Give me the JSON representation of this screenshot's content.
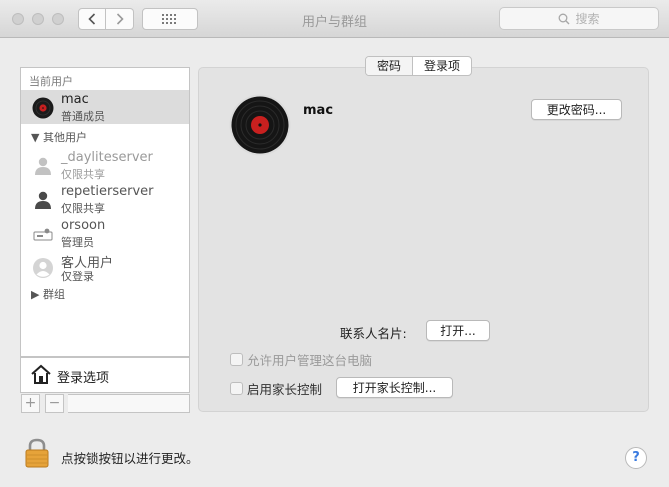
{
  "window": {
    "title": "用户与群组",
    "search_placeholder": "搜索"
  },
  "sidebar": {
    "current_users_header": "当前用户",
    "other_users_header": "其他用户",
    "groups_label": "群组",
    "current_user": {
      "name": "mac",
      "role": "普通成员"
    },
    "other_users": [
      {
        "name": "_dayliteserver",
        "role": "仅限共享"
      },
      {
        "name": "repetierserver",
        "role": "仅限共享"
      },
      {
        "name": "orsoon",
        "role": "管理员"
      },
      {
        "name": "客人用户",
        "role": "仅登录"
      }
    ],
    "login_options_label": "登录选项",
    "add_label": "+",
    "remove_label": "−"
  },
  "tabs": [
    {
      "label": "密码",
      "active": true
    },
    {
      "label": "登录项",
      "active": false
    }
  ],
  "detail": {
    "user_name": "mac",
    "change_password_button": "更改密码...",
    "contact_card_label": "联系人名片:",
    "open_button": "打开...",
    "allow_admin_label": "允许用户管理这台电脑",
    "parental_controls_label": "启用家长控制",
    "open_parental_button": "打开家长控制..."
  },
  "footer": {
    "lock_text": "点按锁按钮以进行更改。",
    "help_label": "?"
  }
}
